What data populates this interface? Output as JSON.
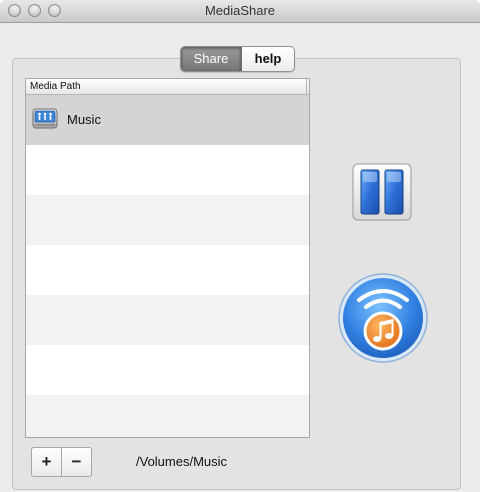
{
  "window": {
    "title": "MediaShare"
  },
  "tabs": [
    {
      "label": "Share",
      "selected": true
    },
    {
      "label": "help",
      "selected": false
    }
  ],
  "media_table": {
    "column_header": "Media Path",
    "rows": [
      {
        "label": "Music",
        "icon": "network-drive-icon",
        "selected": true
      }
    ]
  },
  "controls": {
    "add_label": "+",
    "remove_label": "−",
    "selected_path": "/Volumes/Music"
  },
  "icons": {
    "pause": "pause-icon",
    "stream": "itunes-stream-icon"
  },
  "colors": {
    "accent_blue": "#2d6fd6",
    "music_orange": "#e9832a",
    "selection_gray": "#d4d4d4"
  }
}
